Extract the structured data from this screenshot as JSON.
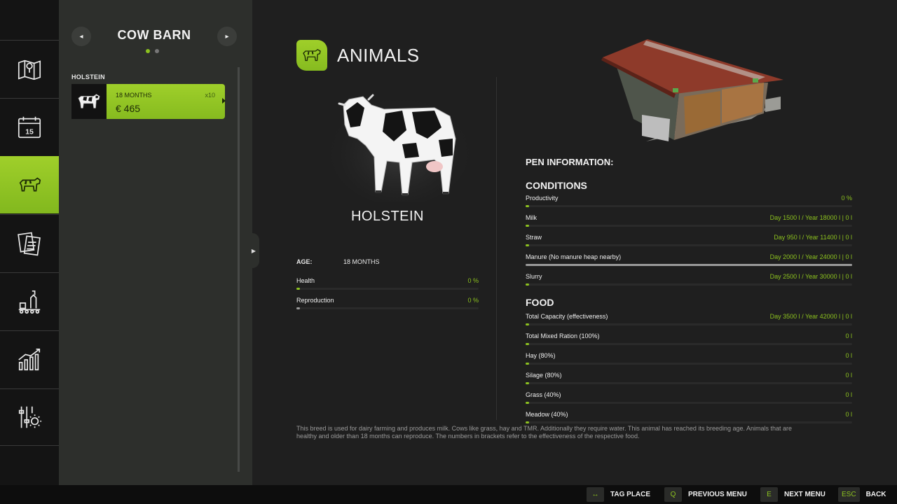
{
  "barn": {
    "title": "COW BARN",
    "group_label": "HOLSTEIN",
    "prev_label": "◂",
    "next_label": "▸"
  },
  "animal_card": {
    "age": "18 MONTHS",
    "count": "x10",
    "price": "€ 465"
  },
  "rail": [
    "map-icon",
    "calendar-icon",
    "cow-icon",
    "contracts-icon",
    "production-icon",
    "prices-icon",
    "settings-icon"
  ],
  "calendar_day": "15",
  "main": {
    "title": "ANIMALS",
    "breed": "HOLSTEIN"
  },
  "age": {
    "label": "AGE:",
    "value": "18 MONTHS"
  },
  "animal_stats": [
    {
      "label": "Health",
      "value": "0 %",
      "level": 0.02
    },
    {
      "label": "Reproduction",
      "value": "0 %",
      "level": 0.02
    }
  ],
  "pen": {
    "title": "PEN INFORMATION:",
    "conditions_title": "CONDITIONS",
    "conditions": [
      {
        "label": "Productivity",
        "value": "0 %",
        "level": 0.01
      },
      {
        "label": "Milk",
        "value": "Day 1500 l / Year 18000 l   |   0 l",
        "level": 0.01
      },
      {
        "label": "Straw",
        "value": "Day 950 l / Year 11400 l   |   0 l",
        "level": 0.01
      },
      {
        "label": "Manure (No manure heap nearby)",
        "value": "Day 2000 l / Year 24000 l   |   0 l",
        "level": 1.0
      },
      {
        "label": "Slurry",
        "value": "Day 2500 l / Year 30000 l   |   0 l",
        "level": 0.01
      }
    ],
    "food_title": "FOOD",
    "food": [
      {
        "label": "Total Capacity (effectiveness)",
        "value": "Day 3500 l / Year 42000 l   |   0 l",
        "level": 0.01
      },
      {
        "label": "Total Mixed Ration (100%)",
        "value": "0 l",
        "level": 0.01
      },
      {
        "label": "Hay (80%)",
        "value": "0 l",
        "level": 0.01
      },
      {
        "label": "Silage (80%)",
        "value": "0 l",
        "level": 0.01
      },
      {
        "label": "Grass (40%)",
        "value": "0 l",
        "level": 0.01
      },
      {
        "label": "Meadow (40%)",
        "value": "0 l",
        "level": 0.01
      }
    ]
  },
  "description": "This breed is used for dairy farming and produces milk. Cows like grass, hay and TMR. Additionally they require water. This animal has reached its breeding age. Animals that are healthy and older than 18 months can reproduce. The numbers in brackets refer to the effectiveness of the respective food.",
  "footer": [
    {
      "key": "↔",
      "label": "TAG PLACE"
    },
    {
      "key": "Q",
      "label": "PREVIOUS MENU"
    },
    {
      "key": "E",
      "label": "NEXT MENU"
    },
    {
      "key": "ESC",
      "label": "BACK"
    }
  ],
  "colors": {
    "accent": "#8cc21f",
    "panel": "#2d2f2c",
    "background": "#1f1f1f"
  }
}
